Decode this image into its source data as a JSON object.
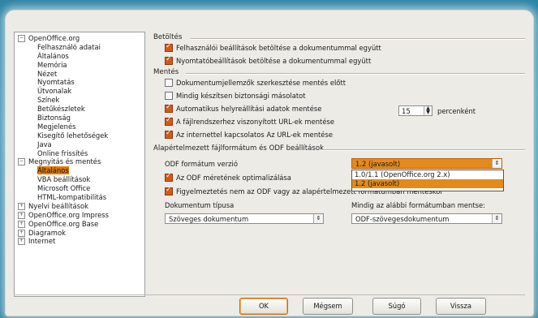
{
  "tree": [
    {
      "label": "OpenOffice.org",
      "type": "parent",
      "expander": "⊟"
    },
    {
      "label": "Felhasználó adatai",
      "type": "child"
    },
    {
      "label": "Általános",
      "type": "child"
    },
    {
      "label": "Memória",
      "type": "child"
    },
    {
      "label": "Nézet",
      "type": "child"
    },
    {
      "label": "Nyomtatás",
      "type": "child"
    },
    {
      "label": "Útvonalak",
      "type": "child"
    },
    {
      "label": "Színek",
      "type": "child"
    },
    {
      "label": "Betűkészletek",
      "type": "child"
    },
    {
      "label": "Biztonság",
      "type": "child"
    },
    {
      "label": "Megjelenés",
      "type": "child"
    },
    {
      "label": "Kisegítő lehetőségek",
      "type": "child"
    },
    {
      "label": "Java",
      "type": "child"
    },
    {
      "label": "Online frissítés",
      "type": "child"
    },
    {
      "label": "Megnyitás és mentés",
      "type": "parent",
      "expander": "⊟"
    },
    {
      "label": "Általános",
      "type": "child",
      "selected": true
    },
    {
      "label": "VBA beállítások",
      "type": "child"
    },
    {
      "label": "Microsoft Office",
      "type": "child"
    },
    {
      "label": "HTML-kompatibilitás",
      "type": "child"
    },
    {
      "label": "Nyelvi beállítások",
      "type": "parent",
      "expander": "⊞"
    },
    {
      "label": "OpenOffice.org Impress",
      "type": "parent",
      "expander": "⊞"
    },
    {
      "label": "OpenOffice.org Base",
      "type": "parent",
      "expander": "⊞"
    },
    {
      "label": "Diagramok",
      "type": "parent",
      "expander": "⊞"
    },
    {
      "label": "Internet",
      "type": "parent",
      "expander": "⊞"
    }
  ],
  "sections": {
    "load": "Betöltés",
    "save": "Mentés",
    "default_format": "Alapértelmezett fájlformátum és ODF beállítások"
  },
  "load": {
    "user_settings": "Felhasználói beállítások betöltése a dokumentummal együtt",
    "printer_settings": "Nyomtatóbeállítások betöltése a dokumentummal együtt"
  },
  "save": {
    "edit_props": "Dokumentumjellemzők szerkesztése mentés előtt",
    "backup": "Mindig készítsen biztonsági másolatot",
    "autorecovery": "Automatikus helyreállítási adatok mentése",
    "autorecovery_minutes": "15",
    "minutes_label": "percenként",
    "url_fs": "A fájlrendszerhez viszonyított URL-ek mentése",
    "url_internet": "Az internettel kapcsolatos Az URL-ek mentése"
  },
  "odf": {
    "version_label": "ODF formátum verzió",
    "version_value": "1.2 (javasolt)",
    "version_options": [
      "1.0/1.1 (OpenOffice.org 2.x)",
      "1.2 (javasolt)"
    ],
    "optimize": "Az ODF méretének optimalizálása",
    "warn": "Figyelmeztetés nem az ODF vagy az alapértelmezett formátumban mentéskor",
    "doc_type_label": "Dokumentum típusa",
    "doc_type_value": "Szöveges dokumentum",
    "always_save_label": "Mindig az alábbi formátumban mentse:",
    "always_save_value": "ODF-szövegesdokumentum"
  },
  "buttons": {
    "ok": "OK",
    "cancel": "Mégsem",
    "help": "Súgó",
    "back": "Vissza"
  },
  "colors": {
    "accent": "#e58a1a",
    "checkbox_checked": "#d45a1a",
    "background": "#2f84a6"
  }
}
